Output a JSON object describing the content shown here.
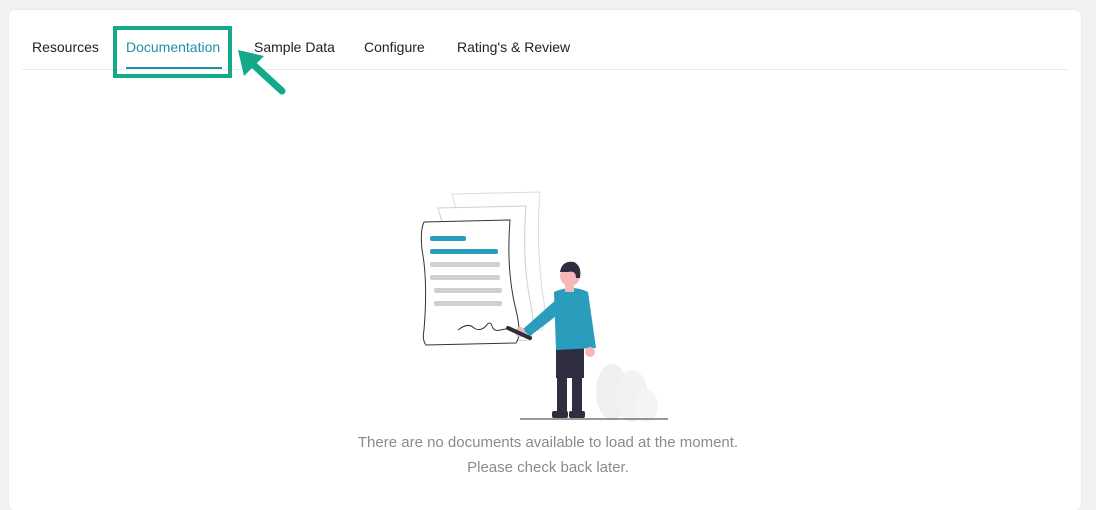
{
  "tabs": [
    {
      "label": "Resources",
      "active": false
    },
    {
      "label": "Documentation",
      "active": true
    },
    {
      "label": "Sample Data",
      "active": false
    },
    {
      "label": "Configure",
      "active": false
    },
    {
      "label": "Rating's & Review",
      "active": false
    }
  ],
  "empty_state": {
    "illustration": "person-signing-document-illustration",
    "line1": "There are no documents available to load at the moment.",
    "line2": "Please check back later."
  },
  "annotation": {
    "highlight_color": "#13a98a",
    "arrow_icon": "pointer-arrow-icon"
  },
  "colors": {
    "accent": "#2090a8",
    "tab_text": "#222222",
    "muted_text": "#8b8b8b"
  }
}
